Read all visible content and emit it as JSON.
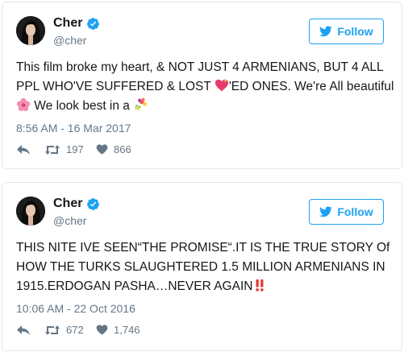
{
  "colors": {
    "brand": "#1da1f2",
    "muted": "#657786",
    "text": "#14171a",
    "border": "#e1e8ed"
  },
  "tweets": [
    {
      "author": {
        "name": "Cher",
        "handle": "@cher",
        "verified": true
      },
      "follow_label": "Follow",
      "text_parts": [
        "This film broke my heart, & NOT JUST 4 ARMENIANS, BUT 4 ALL PPL WHO'VE SUFFERED & LOST ",
        "'ED ONES. We're All beautiful ",
        " We look best in a "
      ],
      "emojis": [
        "sparkling-heart-icon",
        "hibiscus-icon",
        "bouquet-icon"
      ],
      "timestamp": "8:56 AM - 16 Mar 2017",
      "retweets": "197",
      "likes": "866"
    },
    {
      "author": {
        "name": "Cher",
        "handle": "@cher",
        "verified": true
      },
      "follow_label": "Follow",
      "text_parts": [
        "THIS NITE IVE SEEN“THE PROMISE“.IT IS THE TRUE STORY Of HOW THE TURKS SLAUGHTERED 1.5 MILLION ARMENIANS IN 1915.ERDOGAN PASHA…NEVER AGAIN"
      ],
      "emojis": [
        "double-exclamation-icon"
      ],
      "timestamp": "10:06 AM - 22 Oct 2016",
      "retweets": "672",
      "likes": "1,746"
    }
  ]
}
